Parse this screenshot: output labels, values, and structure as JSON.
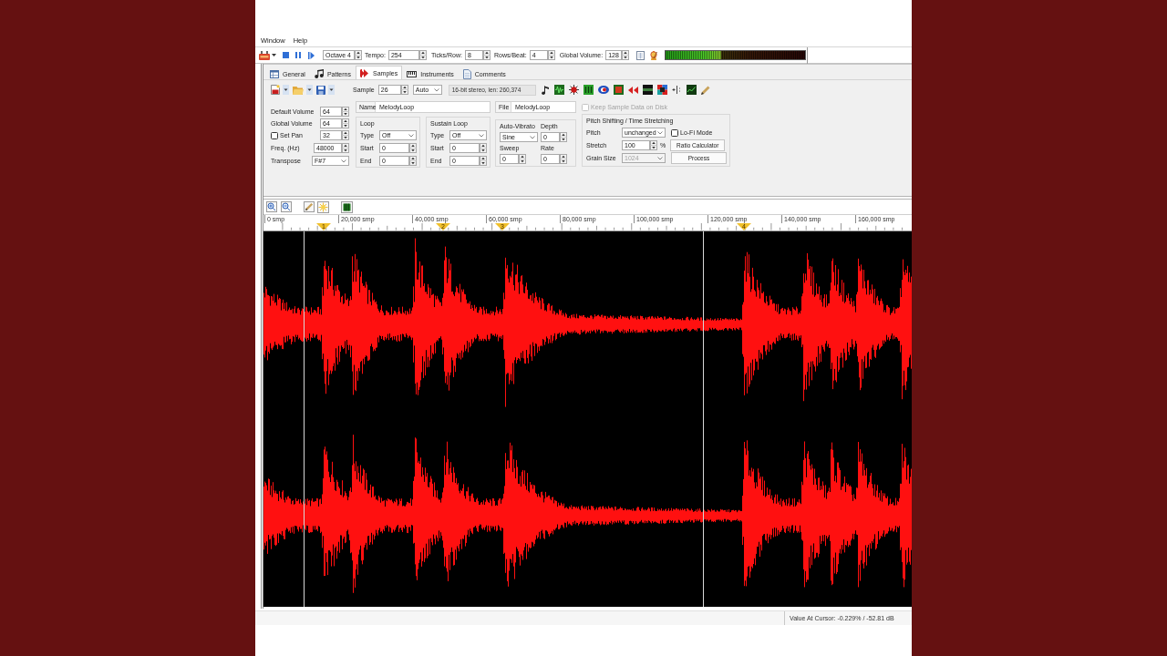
{
  "menu_bar": {
    "items": [
      "Window",
      "Help"
    ]
  },
  "toolbar": {
    "octave": "Octave 4",
    "tempo": {
      "label": "Tempo:",
      "value": "254"
    },
    "ticks_per_row": {
      "label": "Ticks/Row:",
      "value": "8"
    },
    "rows_per_beat": {
      "label": "Rows/Beat:",
      "value": "4"
    },
    "global_volume": {
      "label": "Global Volume:",
      "value": "128"
    },
    "vu_meter": {
      "level": 0.4
    }
  },
  "tabs": [
    {
      "label": "General",
      "selected": false
    },
    {
      "label": "Patterns",
      "selected": false
    },
    {
      "label": "Samples",
      "selected": true
    },
    {
      "label": "Instruments",
      "selected": false
    },
    {
      "label": "Comments",
      "selected": false
    }
  ],
  "sample_bar": {
    "label": "Sample",
    "value": "26",
    "mode": "Auto",
    "info": "16-bit stereo, len: 260,374"
  },
  "sample_settings": [
    {
      "kind": "spin",
      "label": "Default Volume",
      "value": "64"
    },
    {
      "kind": "spin",
      "label": "Global Volume",
      "value": "64"
    },
    {
      "kind": "check",
      "label": "Set Pan",
      "checked": false,
      "value": "32"
    },
    {
      "kind": "spin",
      "label": "Freq. (Hz)",
      "value": "48000"
    },
    {
      "kind": "select",
      "label": "Transpose",
      "value": "F#7"
    }
  ],
  "name": {
    "label": "Name",
    "value": "MelodyLoop"
  },
  "loops": [
    {
      "title": "Loop",
      "type_label": "Type",
      "type": "Off",
      "start_label": "Start",
      "start": "0",
      "end_label": "End",
      "end": "0"
    },
    {
      "title": "Sustain Loop",
      "type_label": "Type",
      "type": "Off",
      "start_label": "Start",
      "start": "0",
      "end_label": "End",
      "end": "0"
    }
  ],
  "file": {
    "label": "File",
    "value": "MelodyLoop"
  },
  "auto_vibrato": {
    "title": "Auto-Vibrato",
    "waveform": "Sine",
    "depth_label": "Depth",
    "depth": "0",
    "sweep_label": "Sweep",
    "sweep": "0",
    "rate_label": "Rate",
    "rate": "0"
  },
  "keep_on_disk": {
    "label": "Keep Sample Data on Disk",
    "checked": false,
    "disabled": true
  },
  "pitch_shifting": {
    "title": "Pitch Shifting / Time Stretching",
    "pitch_label": "Pitch",
    "pitch": "unchanged",
    "lofi": {
      "label": "Lo-Fi Mode",
      "checked": false
    },
    "stretch_label": "Stretch",
    "stretch": "100",
    "stretch_unit": "%",
    "ratio_button": "Ratio Calculator",
    "grain_label": "Grain Size",
    "grain_size": {
      "value": "1024",
      "disabled": true
    },
    "process_button": "Process"
  },
  "sample_editor": {
    "ruler": [
      "0 smp",
      "20,000 smp",
      "40,000 smp",
      "60,000 smp",
      "80,000 smp",
      "100,000 smp",
      "120,000 smp",
      "140,000 smp",
      "160,000 smp"
    ],
    "cue_points": [
      "1",
      "2",
      "3",
      "4"
    ]
  },
  "status_bar": {
    "text": "Value At Cursor: -0.229% / -52.81 dB"
  }
}
